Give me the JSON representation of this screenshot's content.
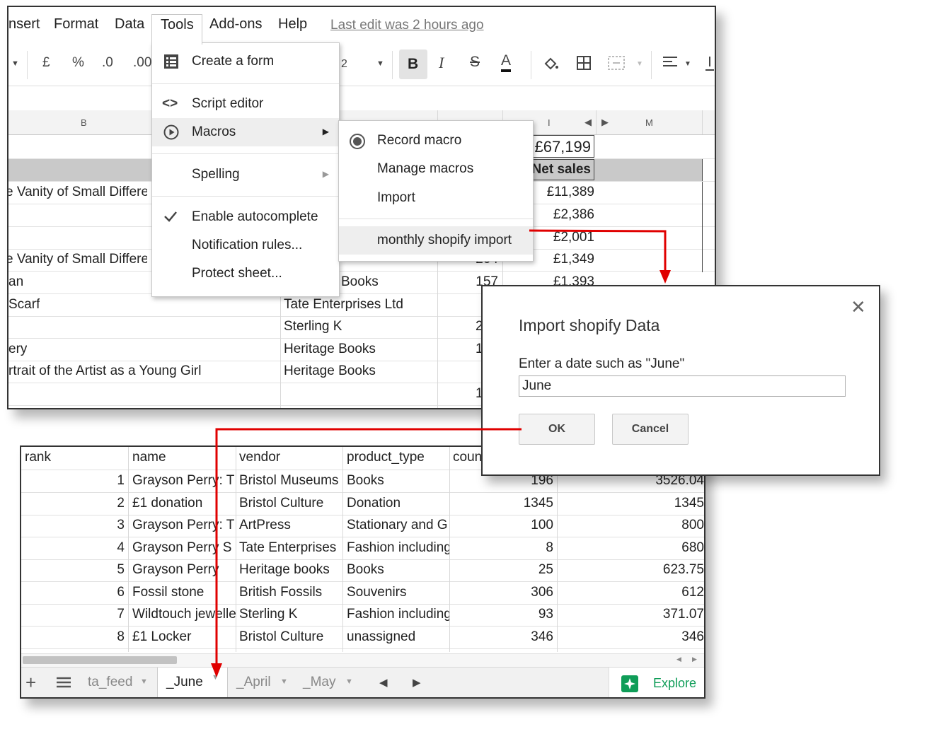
{
  "menubar": {
    "items": [
      "nsert",
      "Format",
      "Data",
      "Tools",
      "Add-ons",
      "Help"
    ],
    "last_edit": "Last edit was 2 hours ago"
  },
  "toolbar": {
    "currency": "£",
    "percent": "%",
    "dec_less": ".0",
    "dec_more": ".00",
    "font_size": "2",
    "bold": "B",
    "italic": "I",
    "strike": "S",
    "text_color": "A"
  },
  "columns": {
    "b": "B",
    "i": "I",
    "m": "M"
  },
  "top_grid": {
    "total": "£67,199",
    "net_sales_header": "Net sales",
    "rows": [
      {
        "b": "e Vanity of Small Differe",
        "vendor": "",
        "count": "",
        "net": "£11,389"
      },
      {
        "b": "",
        "vendor": "",
        "count": "",
        "net": "£2,386"
      },
      {
        "b": "",
        "vendor": "",
        "count": "",
        "net": "£2,001"
      },
      {
        "b": "e Vanity of Small Differe",
        "vendor": "",
        "count": "204",
        "net": "£1,349"
      },
      {
        "b": "an",
        "vendor": "Books",
        "count": "157",
        "net": "£1,393"
      },
      {
        "b": " Scarf",
        "vendor": "Tate Enterprises Ltd",
        "count": "",
        "net": ""
      },
      {
        "b": "",
        "vendor": "Sterling K",
        "count": "2",
        "net": ""
      },
      {
        "b": "ery",
        "vendor": "Heritage Books",
        "count": "1",
        "net": ""
      },
      {
        "b": "rtrait of the Artist as a Young Girl",
        "vendor": "Heritage Books",
        "count": "",
        "net": ""
      },
      {
        "b": "",
        "vendor": "",
        "count": "1",
        "net": ""
      }
    ]
  },
  "tools_menu": {
    "create_form": "Create a form",
    "script_editor": "Script editor",
    "macros": "Macros",
    "spelling": "Spelling",
    "autocomplete": "Enable autocomplete",
    "notification_rules": "Notification rules...",
    "protect_sheet": "Protect sheet..."
  },
  "macros_menu": {
    "record": "Record macro",
    "manage": "Manage macros",
    "import": "Import",
    "monthly": "monthly shopify import"
  },
  "dialog": {
    "title": "Import shopify Data",
    "prompt": "Enter a date such as \"June\"",
    "value": "June",
    "ok": "OK",
    "cancel": "Cancel"
  },
  "june_sheet": {
    "headers": [
      "rank",
      "name",
      "vendor",
      "product_type",
      "coun"
    ],
    "rows": [
      {
        "rank": "1",
        "name": "Grayson Perry: T",
        "vendor": "Bristol Museums",
        "type": "Books",
        "count": "196",
        "value": "3526.04"
      },
      {
        "rank": "2",
        "name": "£1 donation",
        "vendor": "Bristol Culture",
        "type": "Donation",
        "count": "1345",
        "value": "1345"
      },
      {
        "rank": "3",
        "name": "Grayson Perry: T",
        "vendor": "ArtPress",
        "type": "Stationary and G",
        "count": "100",
        "value": "800"
      },
      {
        "rank": "4",
        "name": "Grayson Perry S",
        "vendor": "Tate Enterprises",
        "type": "Fashion including",
        "count": "8",
        "value": "680"
      },
      {
        "rank": "5",
        "name": "Grayson Perry",
        "vendor": "Heritage books",
        "type": "Books",
        "count": "25",
        "value": "623.75"
      },
      {
        "rank": "6",
        "name": "Fossil stone",
        "vendor": "British Fossils",
        "type": "Souvenirs",
        "count": "306",
        "value": "612"
      },
      {
        "rank": "7",
        "name": "Wildtouch jewelle",
        "vendor": "Sterling K",
        "type": "Fashion including",
        "count": "93",
        "value": "371.07"
      },
      {
        "rank": "8",
        "name": "£1 Locker",
        "vendor": "Bristol Culture",
        "type": "unassigned",
        "count": "346",
        "value": "346"
      }
    ]
  },
  "sheet_tabs": {
    "tabs": [
      "ta_feed",
      "_June",
      "_April",
      "_May"
    ],
    "explore": "Explore"
  },
  "colors": {
    "arrow": "#e00000",
    "explore_green": "#0f9d58"
  }
}
